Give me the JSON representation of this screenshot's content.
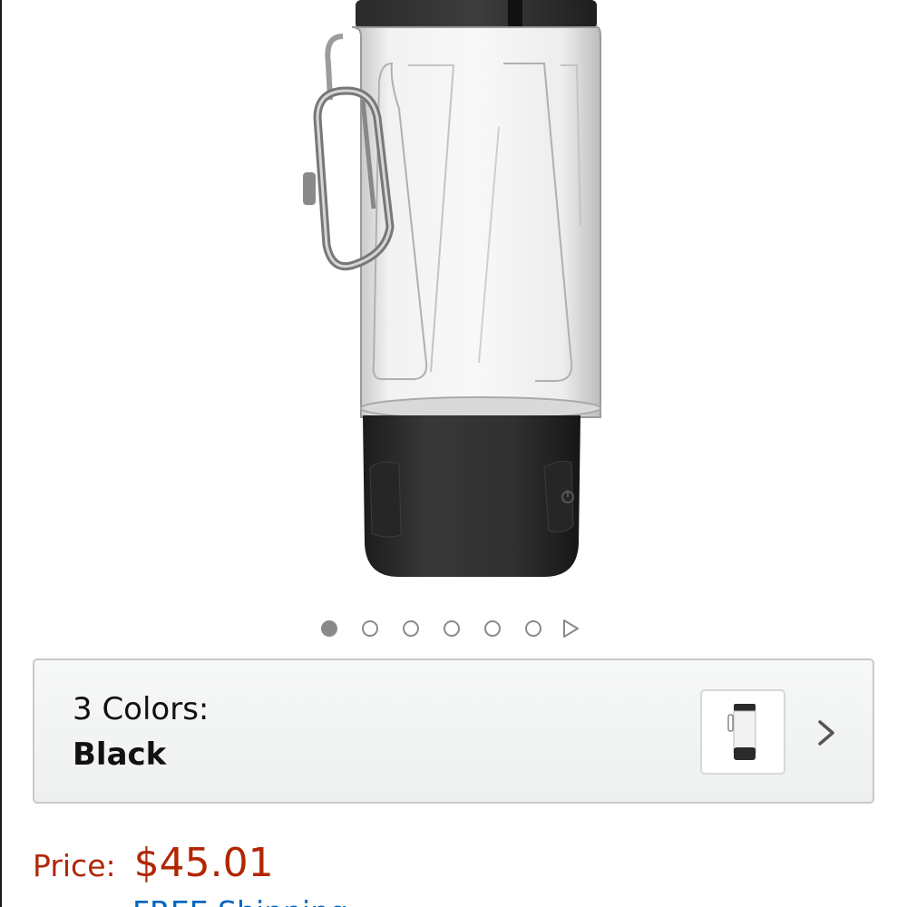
{
  "product": {
    "image_name": "water-bottle-product-image"
  },
  "carousel": {
    "total_dots": 6,
    "active_index": 0,
    "next_icon": "play-triangle-icon"
  },
  "variation": {
    "count_label": "3 Colors:",
    "selected_value": "Black",
    "chevron_icon": "chevron-right-icon"
  },
  "price": {
    "label": "Price:",
    "value": "$45.01"
  },
  "shipping": {
    "label": "FREE Shipping"
  },
  "colors": {
    "price": "#b12704",
    "link": "#0066c0",
    "card_border": "#c9c9c9",
    "dot": "#8a8a8a"
  }
}
